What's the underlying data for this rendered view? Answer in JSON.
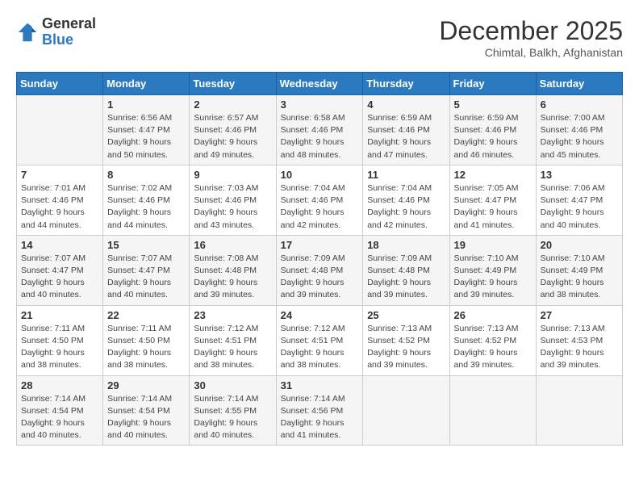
{
  "header": {
    "logo_general": "General",
    "logo_blue": "Blue",
    "month": "December 2025",
    "location": "Chimtal, Balkh, Afghanistan"
  },
  "days_of_week": [
    "Sunday",
    "Monday",
    "Tuesday",
    "Wednesday",
    "Thursday",
    "Friday",
    "Saturday"
  ],
  "weeks": [
    [
      {
        "day": "",
        "info": ""
      },
      {
        "day": "1",
        "info": "Sunrise: 6:56 AM\nSunset: 4:47 PM\nDaylight: 9 hours\nand 50 minutes."
      },
      {
        "day": "2",
        "info": "Sunrise: 6:57 AM\nSunset: 4:46 PM\nDaylight: 9 hours\nand 49 minutes."
      },
      {
        "day": "3",
        "info": "Sunrise: 6:58 AM\nSunset: 4:46 PM\nDaylight: 9 hours\nand 48 minutes."
      },
      {
        "day": "4",
        "info": "Sunrise: 6:59 AM\nSunset: 4:46 PM\nDaylight: 9 hours\nand 47 minutes."
      },
      {
        "day": "5",
        "info": "Sunrise: 6:59 AM\nSunset: 4:46 PM\nDaylight: 9 hours\nand 46 minutes."
      },
      {
        "day": "6",
        "info": "Sunrise: 7:00 AM\nSunset: 4:46 PM\nDaylight: 9 hours\nand 45 minutes."
      }
    ],
    [
      {
        "day": "7",
        "info": "Sunrise: 7:01 AM\nSunset: 4:46 PM\nDaylight: 9 hours\nand 44 minutes."
      },
      {
        "day": "8",
        "info": "Sunrise: 7:02 AM\nSunset: 4:46 PM\nDaylight: 9 hours\nand 44 minutes."
      },
      {
        "day": "9",
        "info": "Sunrise: 7:03 AM\nSunset: 4:46 PM\nDaylight: 9 hours\nand 43 minutes."
      },
      {
        "day": "10",
        "info": "Sunrise: 7:04 AM\nSunset: 4:46 PM\nDaylight: 9 hours\nand 42 minutes."
      },
      {
        "day": "11",
        "info": "Sunrise: 7:04 AM\nSunset: 4:46 PM\nDaylight: 9 hours\nand 42 minutes."
      },
      {
        "day": "12",
        "info": "Sunrise: 7:05 AM\nSunset: 4:47 PM\nDaylight: 9 hours\nand 41 minutes."
      },
      {
        "day": "13",
        "info": "Sunrise: 7:06 AM\nSunset: 4:47 PM\nDaylight: 9 hours\nand 40 minutes."
      }
    ],
    [
      {
        "day": "14",
        "info": "Sunrise: 7:07 AM\nSunset: 4:47 PM\nDaylight: 9 hours\nand 40 minutes."
      },
      {
        "day": "15",
        "info": "Sunrise: 7:07 AM\nSunset: 4:47 PM\nDaylight: 9 hours\nand 40 minutes."
      },
      {
        "day": "16",
        "info": "Sunrise: 7:08 AM\nSunset: 4:48 PM\nDaylight: 9 hours\nand 39 minutes."
      },
      {
        "day": "17",
        "info": "Sunrise: 7:09 AM\nSunset: 4:48 PM\nDaylight: 9 hours\nand 39 minutes."
      },
      {
        "day": "18",
        "info": "Sunrise: 7:09 AM\nSunset: 4:48 PM\nDaylight: 9 hours\nand 39 minutes."
      },
      {
        "day": "19",
        "info": "Sunrise: 7:10 AM\nSunset: 4:49 PM\nDaylight: 9 hours\nand 39 minutes."
      },
      {
        "day": "20",
        "info": "Sunrise: 7:10 AM\nSunset: 4:49 PM\nDaylight: 9 hours\nand 38 minutes."
      }
    ],
    [
      {
        "day": "21",
        "info": "Sunrise: 7:11 AM\nSunset: 4:50 PM\nDaylight: 9 hours\nand 38 minutes."
      },
      {
        "day": "22",
        "info": "Sunrise: 7:11 AM\nSunset: 4:50 PM\nDaylight: 9 hours\nand 38 minutes."
      },
      {
        "day": "23",
        "info": "Sunrise: 7:12 AM\nSunset: 4:51 PM\nDaylight: 9 hours\nand 38 minutes."
      },
      {
        "day": "24",
        "info": "Sunrise: 7:12 AM\nSunset: 4:51 PM\nDaylight: 9 hours\nand 38 minutes."
      },
      {
        "day": "25",
        "info": "Sunrise: 7:13 AM\nSunset: 4:52 PM\nDaylight: 9 hours\nand 39 minutes."
      },
      {
        "day": "26",
        "info": "Sunrise: 7:13 AM\nSunset: 4:52 PM\nDaylight: 9 hours\nand 39 minutes."
      },
      {
        "day": "27",
        "info": "Sunrise: 7:13 AM\nSunset: 4:53 PM\nDaylight: 9 hours\nand 39 minutes."
      }
    ],
    [
      {
        "day": "28",
        "info": "Sunrise: 7:14 AM\nSunset: 4:54 PM\nDaylight: 9 hours\nand 40 minutes."
      },
      {
        "day": "29",
        "info": "Sunrise: 7:14 AM\nSunset: 4:54 PM\nDaylight: 9 hours\nand 40 minutes."
      },
      {
        "day": "30",
        "info": "Sunrise: 7:14 AM\nSunset: 4:55 PM\nDaylight: 9 hours\nand 40 minutes."
      },
      {
        "day": "31",
        "info": "Sunrise: 7:14 AM\nSunset: 4:56 PM\nDaylight: 9 hours\nand 41 minutes."
      },
      {
        "day": "",
        "info": ""
      },
      {
        "day": "",
        "info": ""
      },
      {
        "day": "",
        "info": ""
      }
    ]
  ]
}
